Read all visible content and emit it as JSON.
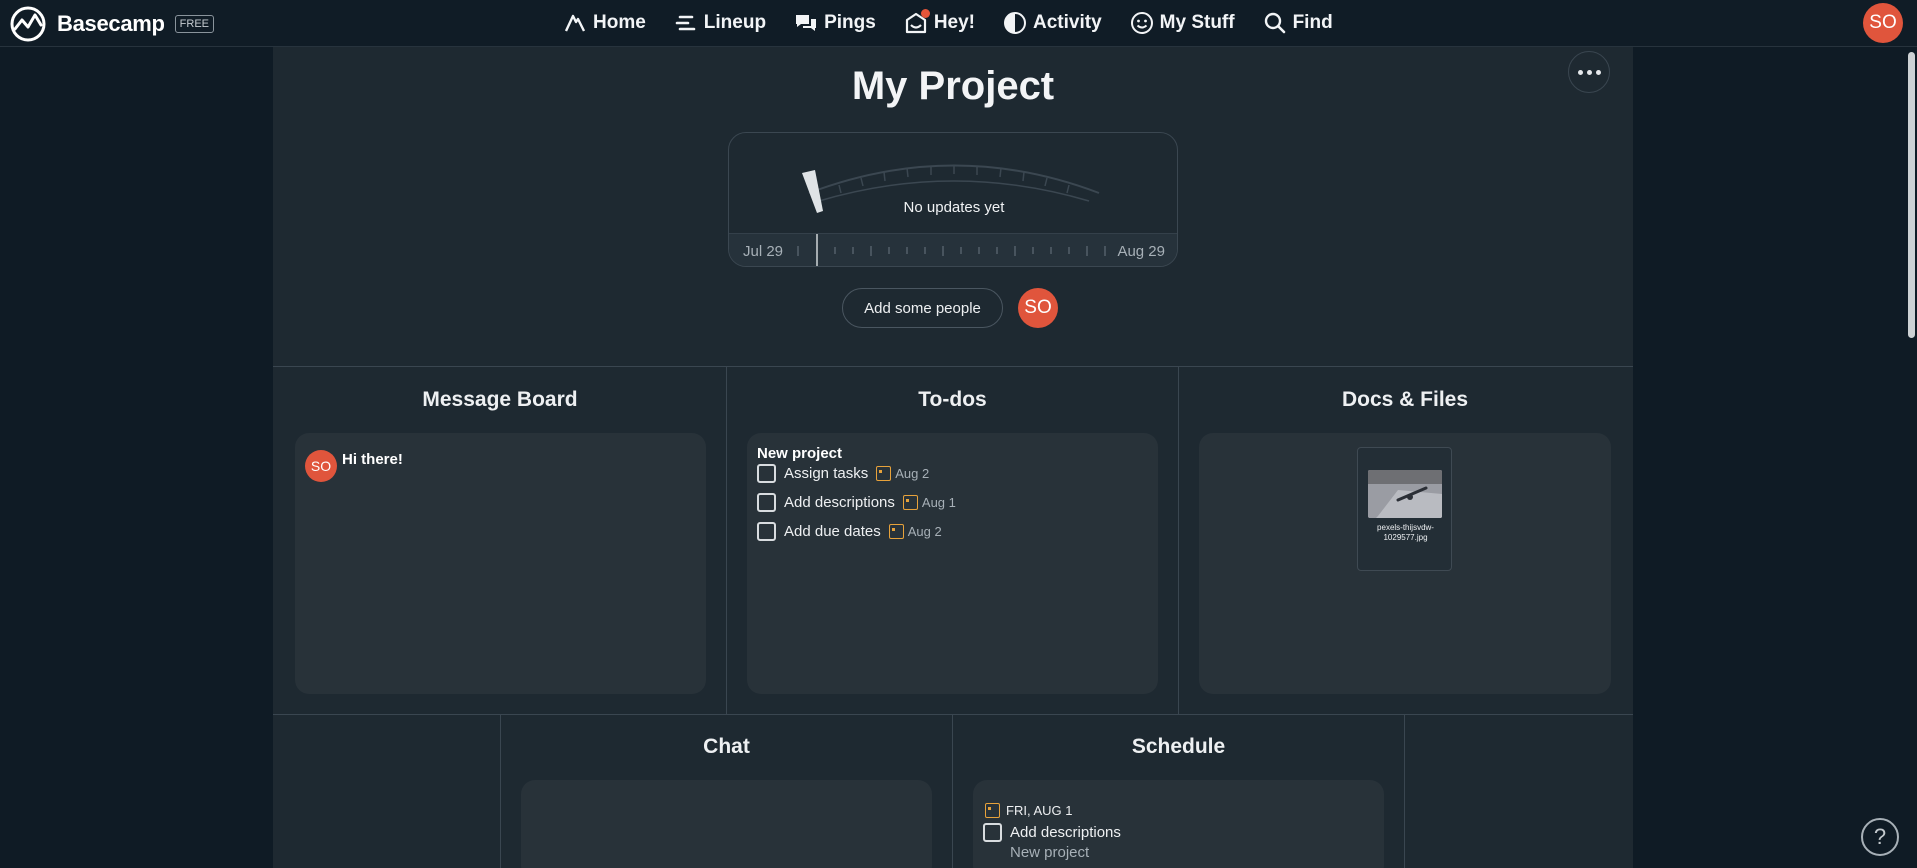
{
  "brand": {
    "name": "Basecamp",
    "badge": "FREE"
  },
  "nav": {
    "home": "Home",
    "lineup": "Lineup",
    "pings": "Pings",
    "hey": "Hey!",
    "activity": "Activity",
    "mystuff": "My Stuff",
    "find": "Find"
  },
  "user": {
    "initials": "SO"
  },
  "project": {
    "title": "My Project",
    "hill_message": "No updates yet",
    "date_start": "Jul 29",
    "date_end": "Aug 29",
    "add_people_label": "Add some people"
  },
  "tools": {
    "message_board": {
      "title": "Message Board",
      "messages": [
        {
          "author_initials": "SO",
          "title": "Hi there!"
        }
      ]
    },
    "todos": {
      "title": "To-dos",
      "list_name": "New project",
      "items": [
        {
          "label": "Assign tasks",
          "due": "Aug 2"
        },
        {
          "label": "Add descriptions",
          "due": "Aug 1"
        },
        {
          "label": "Add due dates",
          "due": "Aug 2"
        }
      ]
    },
    "docs": {
      "title": "Docs & Files",
      "files": [
        {
          "name": "pexels-thijsvdw-1029577.jpg"
        }
      ]
    },
    "chat": {
      "title": "Chat"
    },
    "schedule": {
      "title": "Schedule",
      "date": "FRI, AUG 1",
      "item": "Add descriptions",
      "item_sub": "New project"
    }
  },
  "help": {
    "label": "?"
  },
  "colors": {
    "background": "#0f1b25",
    "panel": "#1e2931",
    "card": "#283239",
    "accent_avatar": "#e0553c",
    "calendar_icon": "#e7a23b"
  }
}
